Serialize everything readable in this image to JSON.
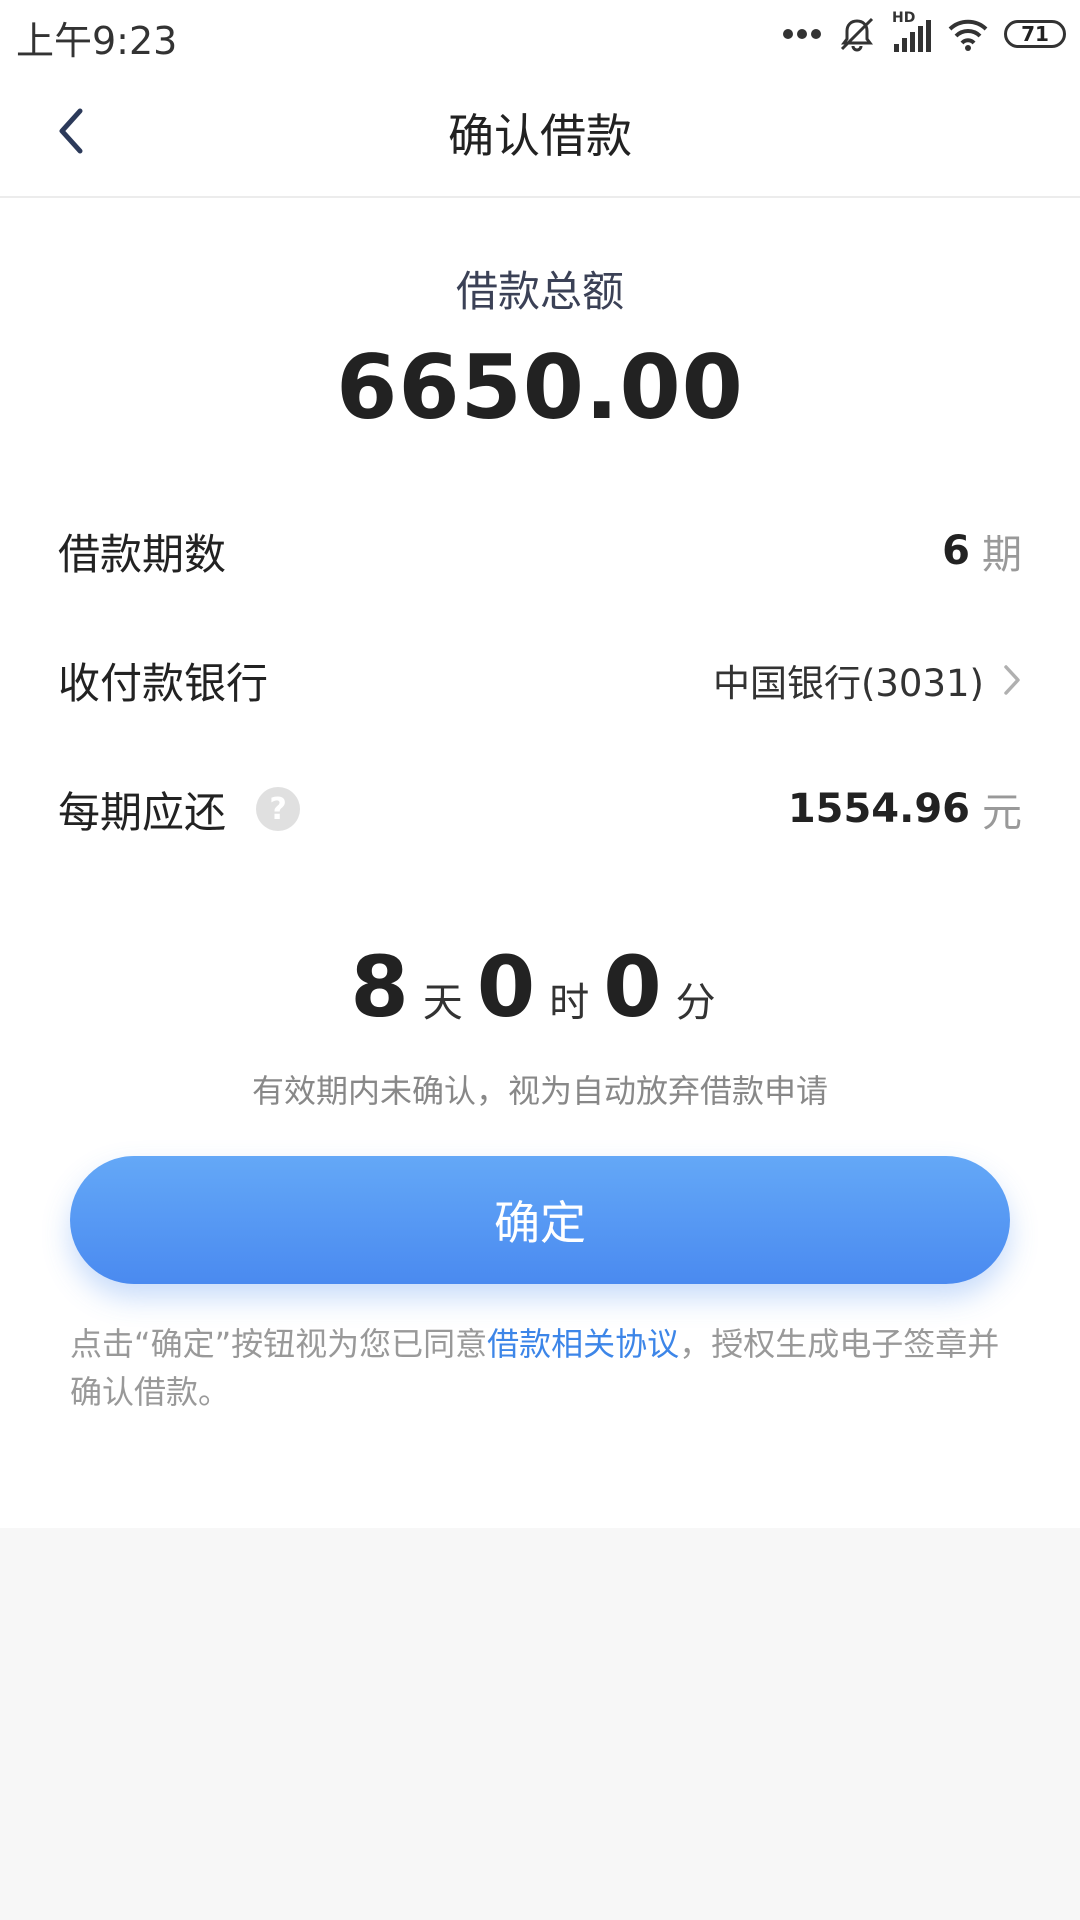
{
  "status_bar": {
    "time": "上午9:23",
    "battery": "71",
    "hd": "HD"
  },
  "nav": {
    "title": "确认借款"
  },
  "loan": {
    "total_label": "借款总额",
    "total_amount": "6650.00",
    "term_label": "借款期数",
    "term_value": "6",
    "term_unit": "期",
    "bank_label": "收付款银行",
    "bank_value": "中国银行(3031)",
    "installment_label": "每期应还",
    "installment_value": "1554.96",
    "installment_unit": "元"
  },
  "countdown": {
    "days": "8",
    "days_unit": "天",
    "hours": "0",
    "hours_unit": "时",
    "minutes": "0",
    "minutes_unit": "分",
    "hint": "有效期内未确认，视为自动放弃借款申请"
  },
  "confirm_button": "确定",
  "agreement": {
    "prefix": "点击“确定”按钮视为您已同意",
    "link": "借款相关协议",
    "suffix": "，授权生成电子签章并确认借款。"
  },
  "colors": {
    "accent": "#4a8af0",
    "link": "#3d86e8",
    "muted": "#999999"
  },
  "icons": [
    "more-icon",
    "mute-icon",
    "signal-icon",
    "wifi-icon",
    "battery-icon",
    "back-icon",
    "help-icon",
    "chevron-right-icon"
  ]
}
